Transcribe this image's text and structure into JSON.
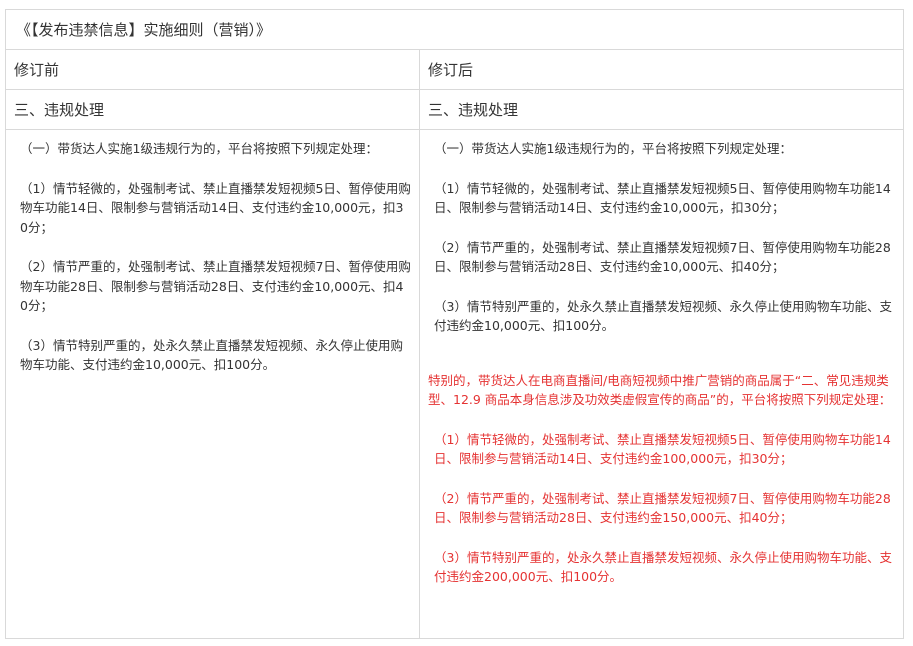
{
  "title": "《【发布违禁信息】实施细则（营销）》",
  "headers": {
    "before": "修订前",
    "after": "修订后"
  },
  "section": {
    "before": "三、违规处理",
    "after": "三、违规处理"
  },
  "before": {
    "intro": "（一）带货达人实施1级违规行为的，平台将按照下列规定处理：",
    "items": [
      "（1）情节轻微的，处强制考试、禁止直播禁发短视频5日、暂停使用购物车功能14日、限制参与营销活动14日、支付违约金10,000元，扣30分；",
      "（2）情节严重的，处强制考试、禁止直播禁发短视频7日、暂停使用购物车功能28日、限制参与营销活动28日、支付违约金10,000元、扣40分；",
      "（3）情节特别严重的，处永久禁止直播禁发短视频、永久停止使用购物车功能、支付违约金10,000元、扣100分。"
    ]
  },
  "after": {
    "intro": "（一）带货达人实施1级违规行为的，平台将按照下列规定处理：",
    "items": [
      "（1）情节轻微的，处强制考试、禁止直播禁发短视频5日、暂停使用购物车功能14日、限制参与营销活动14日、支付违约金10,000元，扣30分；",
      "（2）情节严重的，处强制考试、禁止直播禁发短视频7日、暂停使用购物车功能28日、限制参与营销活动28日、支付违约金10,000元、扣40分；",
      "（3）情节特别严重的，处永久禁止直播禁发短视频、永久停止使用购物车功能、支付违约金10,000元、扣100分。"
    ],
    "special_intro": "特别的，带货达人在电商直播间/电商短视频中推广营销的商品属于“二、常见违规类型、12.9 商品本身信息涉及功效类虚假宣传的商品”的，平台将按照下列规定处理：",
    "special_items": [
      "（1）情节轻微的，处强制考试、禁止直播禁发短视频5日、暂停使用购物车功能14日、限制参与营销活动14日、支付违约金100,000元，扣30分；",
      "（2）情节严重的，处强制考试、禁止直播禁发短视频7日、暂停使用购物车功能28日、限制参与营销活动28日、支付违约金150,000元、扣40分；",
      "（3）情节特别严重的，处永久禁止直播禁发短视频、永久停止使用购物车功能、支付违约金200,000元、扣100分。"
    ]
  },
  "colors": {
    "text": "#333333",
    "border": "#d9d9d9",
    "highlight": "#e53333"
  }
}
